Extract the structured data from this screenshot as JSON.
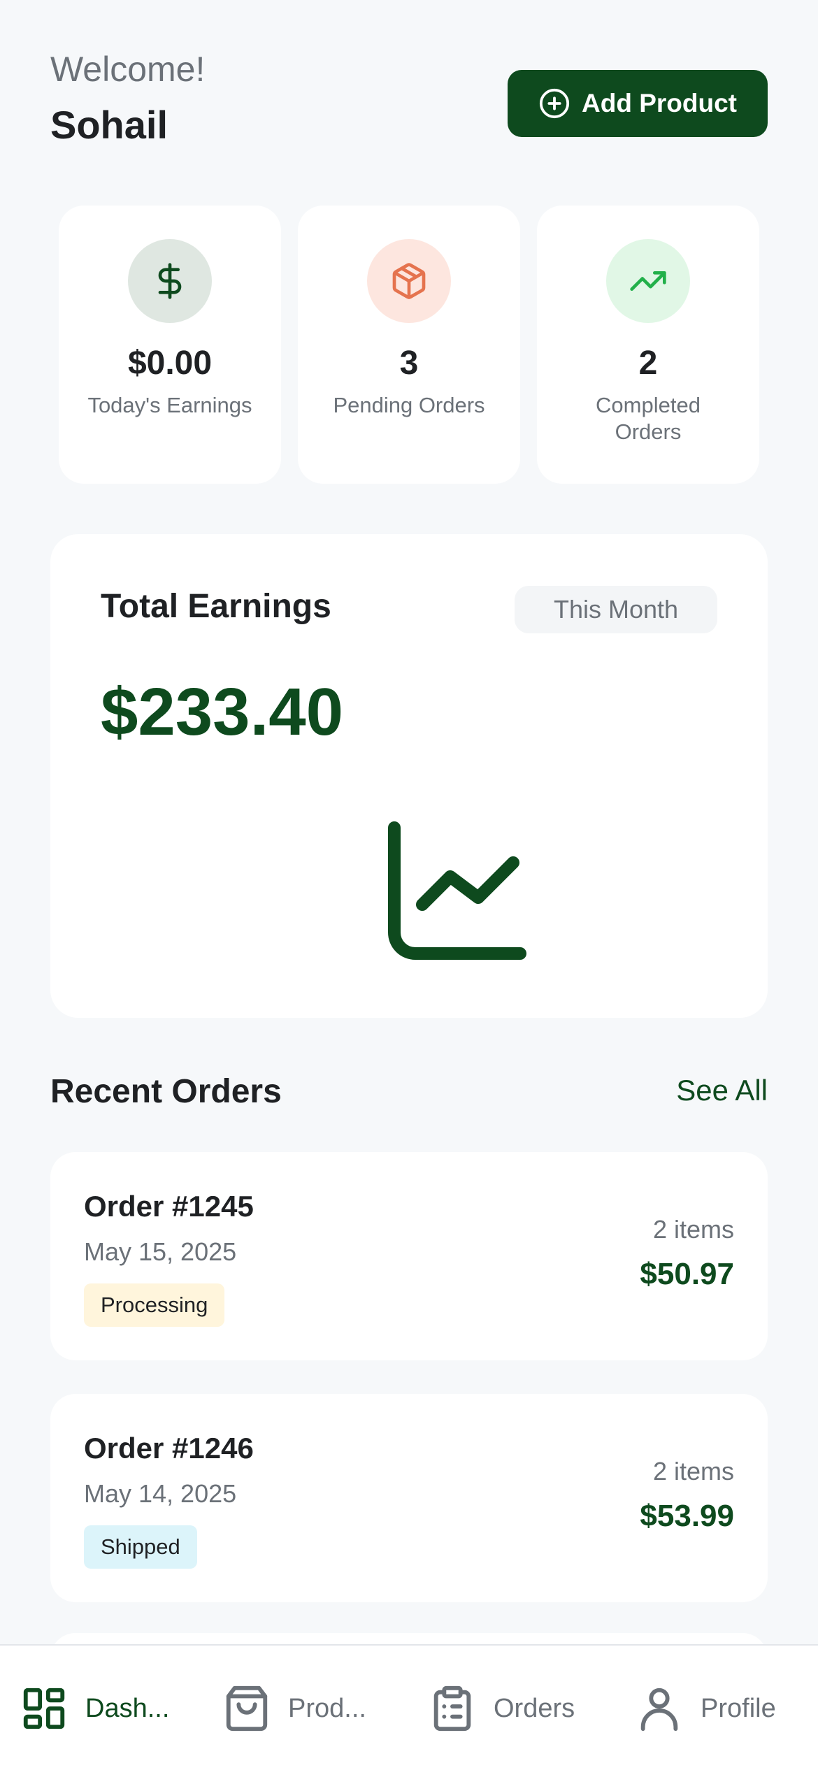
{
  "header": {
    "welcome": "Welcome!",
    "username": "Sohail",
    "add_product_label": "Add Product"
  },
  "stats": [
    {
      "icon": "dollar-icon",
      "value": "$0.00",
      "label": "Today's Earnings",
      "circle_color": "#dfe7e1",
      "icon_color": "#0e4a1e"
    },
    {
      "icon": "box-icon",
      "value": "3",
      "label": "Pending Orders",
      "circle_color": "#fde6df",
      "icon_color": "#e5734e"
    },
    {
      "icon": "trending-up-icon",
      "value": "2",
      "label": "Completed Orders",
      "circle_color": "#e1f7e6",
      "icon_color": "#22b04a"
    }
  ],
  "earnings": {
    "title": "Total Earnings",
    "period": "This Month",
    "amount": "$233.40",
    "icon": "line-chart-icon"
  },
  "recent_orders": {
    "title": "Recent Orders",
    "see_all": "See All",
    "orders": [
      {
        "id": "Order #1245",
        "date": "May 15, 2025",
        "status": "Processing",
        "status_color": "#fff5dc",
        "items": "2 items",
        "total": "$50.97"
      },
      {
        "id": "Order #1246",
        "date": "May 14, 2025",
        "status": "Shipped",
        "status_color": "#dcf4fa",
        "items": "2 items",
        "total": "$53.99"
      }
    ]
  },
  "nav": {
    "items": [
      {
        "label": "Dash...",
        "icon": "dashboard-icon",
        "active": true
      },
      {
        "label": "Prod...",
        "icon": "shopping-bag-icon",
        "active": false
      },
      {
        "label": "Orders",
        "icon": "clipboard-list-icon",
        "active": false
      },
      {
        "label": "Profile",
        "icon": "user-icon",
        "active": false
      }
    ]
  },
  "colors": {
    "brand": "#0e4a1e",
    "background": "#f6f8fa"
  }
}
